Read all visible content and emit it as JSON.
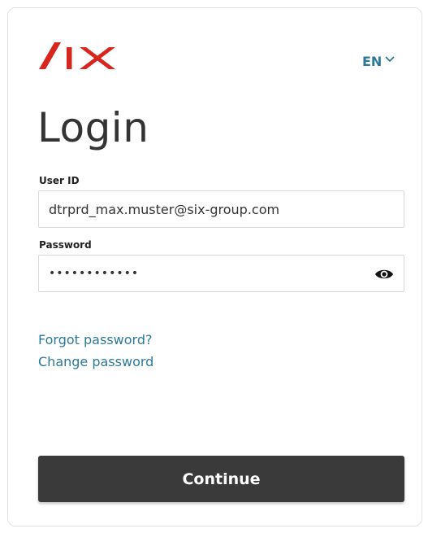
{
  "brand": {
    "logo_text": "SIX",
    "accent_color": "#d7261e",
    "link_color": "#2b7a98"
  },
  "language": {
    "selected": "EN",
    "icon": "chevron-down-icon"
  },
  "title": "Login",
  "user_id": {
    "label": "User ID",
    "value": "dtrprd_max.muster@six-group.com"
  },
  "password": {
    "label": "Password",
    "value": "••••••••••••",
    "toggle_icon": "eye-icon"
  },
  "links": {
    "forgot": "Forgot password?",
    "change": "Change password"
  },
  "continue_label": "Continue"
}
